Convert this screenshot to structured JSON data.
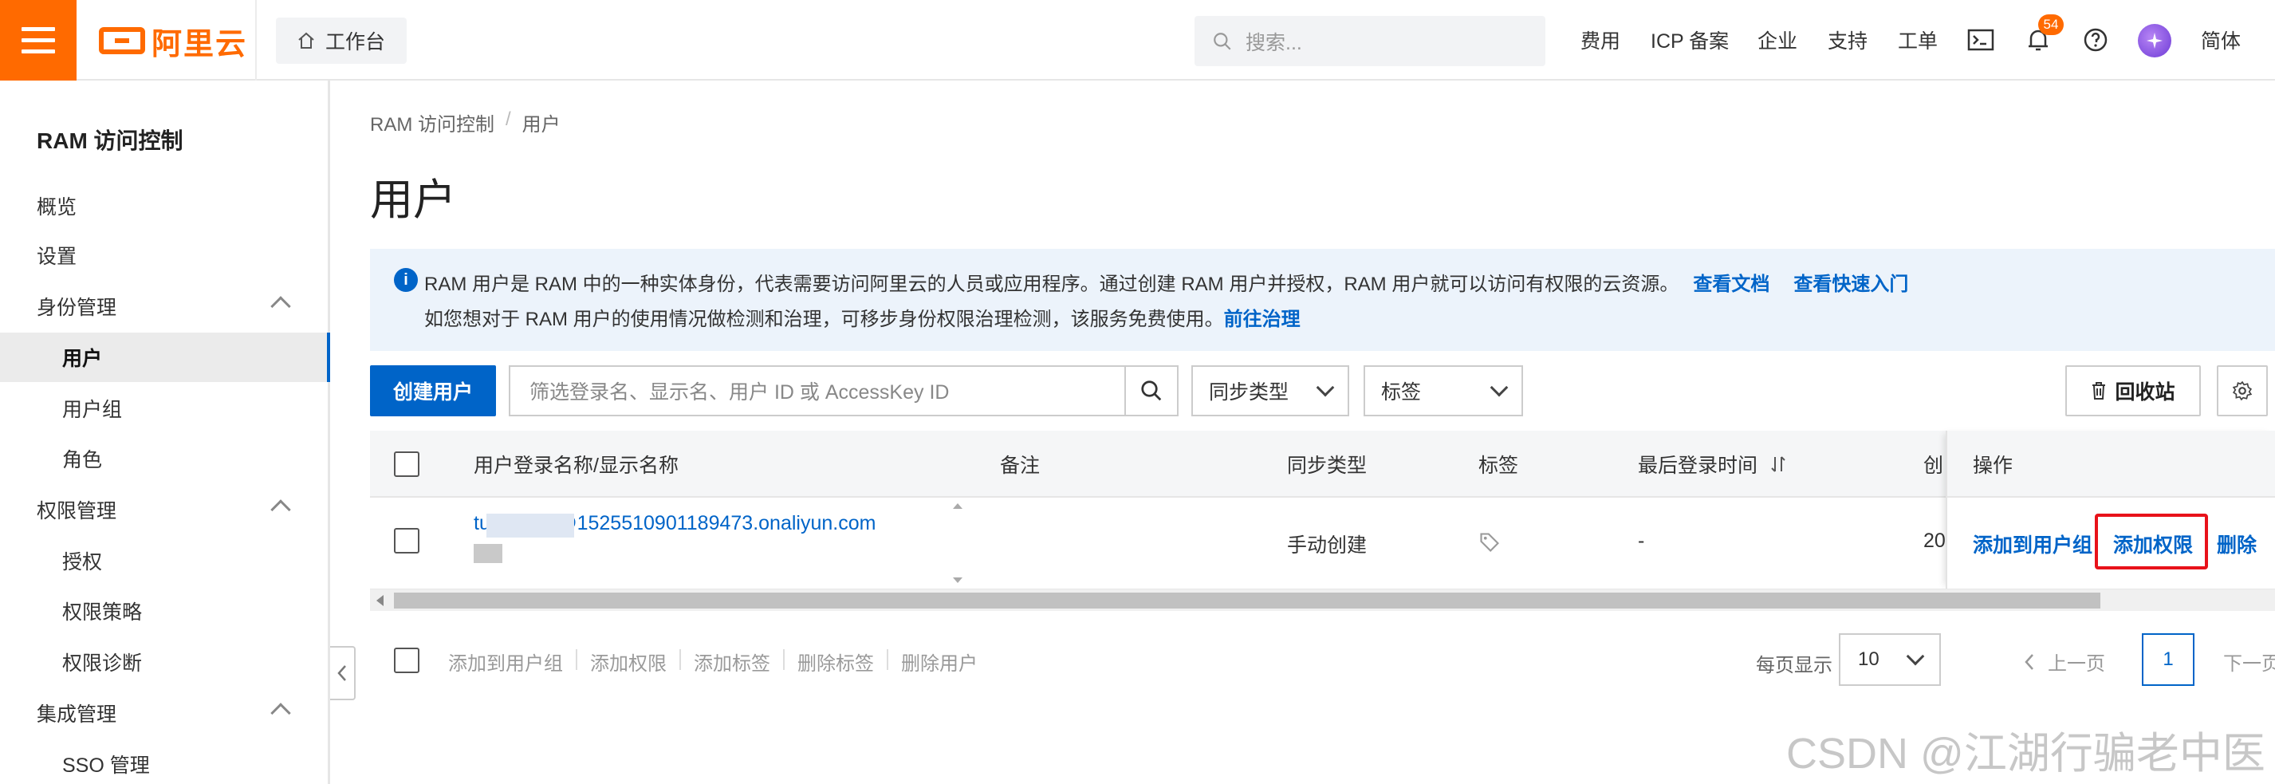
{
  "topbar": {
    "logo_text": "阿里云",
    "workbench_label": "工作台",
    "search_placeholder": "搜索...",
    "nav": [
      "费用",
      "ICP 备案",
      "企业",
      "支持",
      "工单"
    ],
    "notification_count": "54",
    "language": "简体",
    "accent_color": "#ff6a00"
  },
  "sidebar": {
    "title": "RAM 访问控制",
    "items": [
      {
        "label": "概览",
        "level": 1
      },
      {
        "label": "设置",
        "level": 1
      },
      {
        "label": "身份管理",
        "level": 1,
        "expanded": true
      },
      {
        "label": "用户",
        "level": 2,
        "active": true
      },
      {
        "label": "用户组",
        "level": 2
      },
      {
        "label": "角色",
        "level": 2
      },
      {
        "label": "权限管理",
        "level": 1,
        "expanded": true
      },
      {
        "label": "授权",
        "level": 2
      },
      {
        "label": "权限策略",
        "level": 2
      },
      {
        "label": "权限诊断",
        "level": 2
      },
      {
        "label": "集成管理",
        "level": 1,
        "expanded": true
      },
      {
        "label": "SSO 管理",
        "level": 2
      }
    ]
  },
  "breadcrumb": [
    "RAM 访问控制",
    "/",
    "用户"
  ],
  "page_title": "用户",
  "notice": {
    "line1": "RAM 用户是 RAM 中的一种实体身份，代表需要访问阿里云的人员或应用程序。通过创建 RAM 用户并授权，RAM 用户就可以访问有权限的云资源。",
    "link1": "查看文档",
    "link2": "查看快速入门",
    "line2": "如您想对于 RAM 用户的使用情况做检测和治理，可移步身份权限治理检测，该服务免费使用。",
    "link3": "前往治理"
  },
  "toolbar": {
    "create_label": "创建用户",
    "filter_placeholder": "筛选登录名、显示名、用户 ID 或 AccessKey ID",
    "sync_type_label": "同步类型",
    "tag_label": "标签",
    "recycle_label": "回收站"
  },
  "table": {
    "headers": {
      "name": "用户登录名称/显示名称",
      "remark": "备注",
      "sync_type": "同步类型",
      "tags": "标签",
      "last_login": "最后登录时间",
      "created": "创",
      "actions": "操作"
    },
    "rows": [
      {
        "login_name": "tu          g@1525510901189473.onaliyun.com",
        "display_name": "",
        "remark": "",
        "sync_type": "手动创建",
        "last_login": "-",
        "created": "20",
        "actions": [
          "添加到用户组",
          "添加权限",
          "删除"
        ]
      }
    ]
  },
  "batch_actions": [
    "添加到用户组",
    "添加权限",
    "添加标签",
    "删除标签",
    "删除用户"
  ],
  "pagination": {
    "page_size_label": "每页显示",
    "page_size": "10",
    "prev_label": "上一页",
    "current_page": "1",
    "next_label": "下一页"
  },
  "watermark": "CSDN @江湖行骗老中医",
  "colors": {
    "link": "#0064c8",
    "highlight": "#e8121a"
  }
}
